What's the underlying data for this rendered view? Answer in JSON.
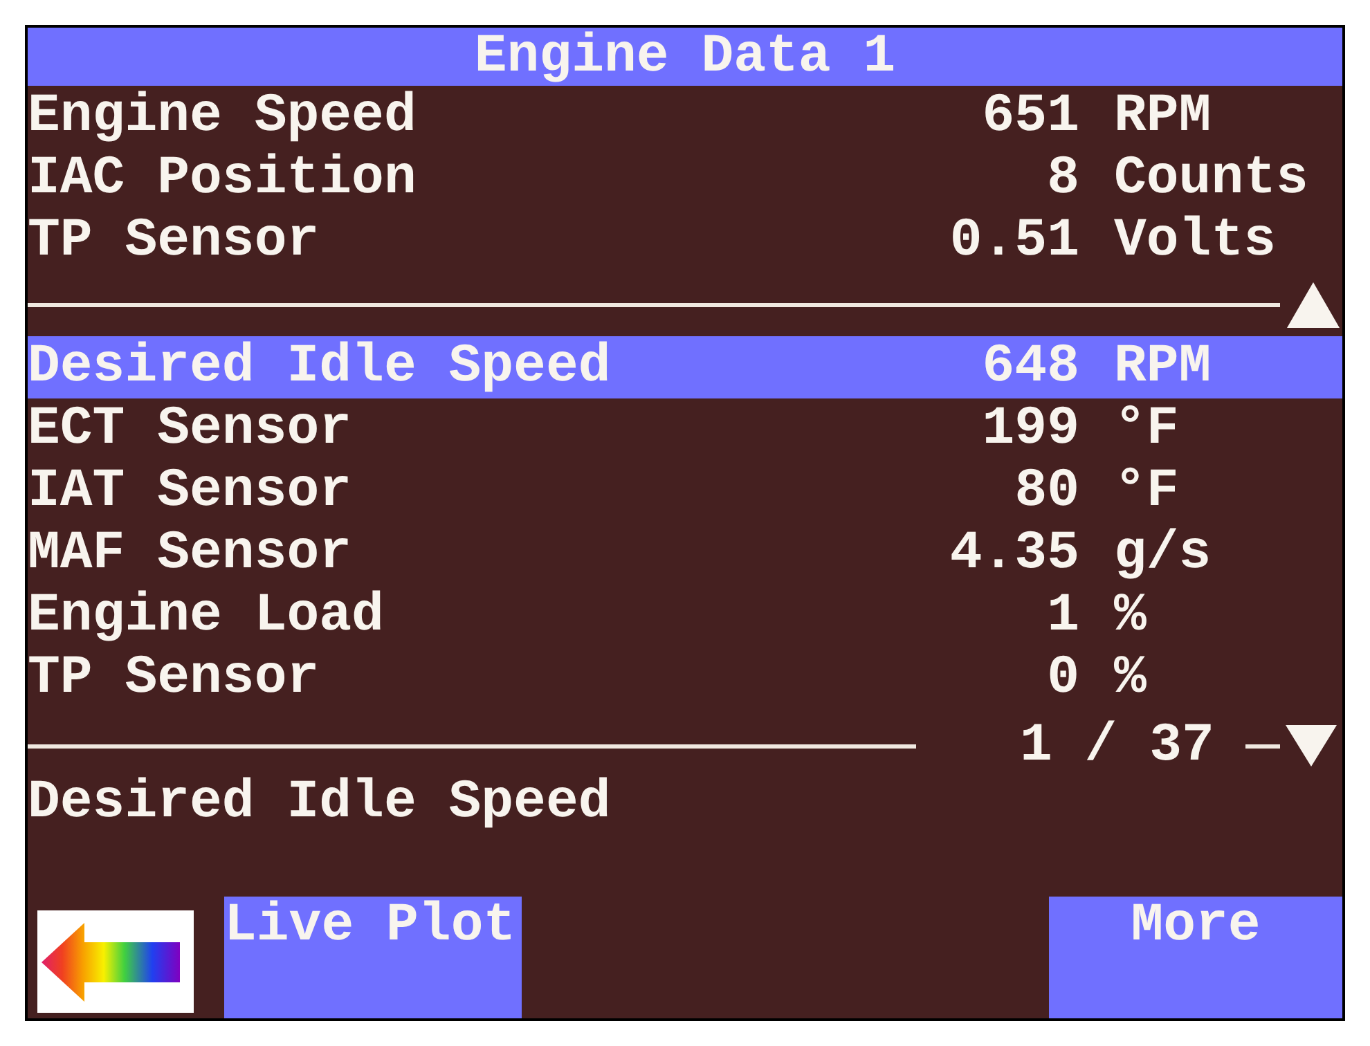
{
  "title": "Engine Data 1",
  "pinned_rows": [
    {
      "name": "Engine Speed",
      "value": "651",
      "unit": "RPM"
    },
    {
      "name": "IAC Position",
      "value": "8",
      "unit": "Counts"
    },
    {
      "name": "TP Sensor",
      "value": "0.51",
      "unit": "Volts"
    }
  ],
  "rows": [
    {
      "name": "Desired Idle Speed",
      "value": "648",
      "unit": "RPM",
      "selected": true
    },
    {
      "name": "ECT Sensor",
      "value": "199",
      "unit": "°F",
      "selected": false
    },
    {
      "name": "IAT Sensor",
      "value": "80",
      "unit": "°F",
      "selected": false
    },
    {
      "name": "MAF Sensor",
      "value": "4.35",
      "unit": "g/s",
      "selected": false
    },
    {
      "name": "Engine Load",
      "value": "1",
      "unit": "%",
      "selected": false
    },
    {
      "name": "TP Sensor",
      "value": "0",
      "unit": "%",
      "selected": false
    }
  ],
  "pager": {
    "position": "1 / 37"
  },
  "detail": "Desired Idle Speed",
  "softkeys": {
    "left": [
      {
        "kind": "back"
      },
      {
        "kind": "text",
        "label": "Live Plot"
      }
    ],
    "right": [
      {
        "kind": "text",
        "label": "More"
      }
    ]
  }
}
